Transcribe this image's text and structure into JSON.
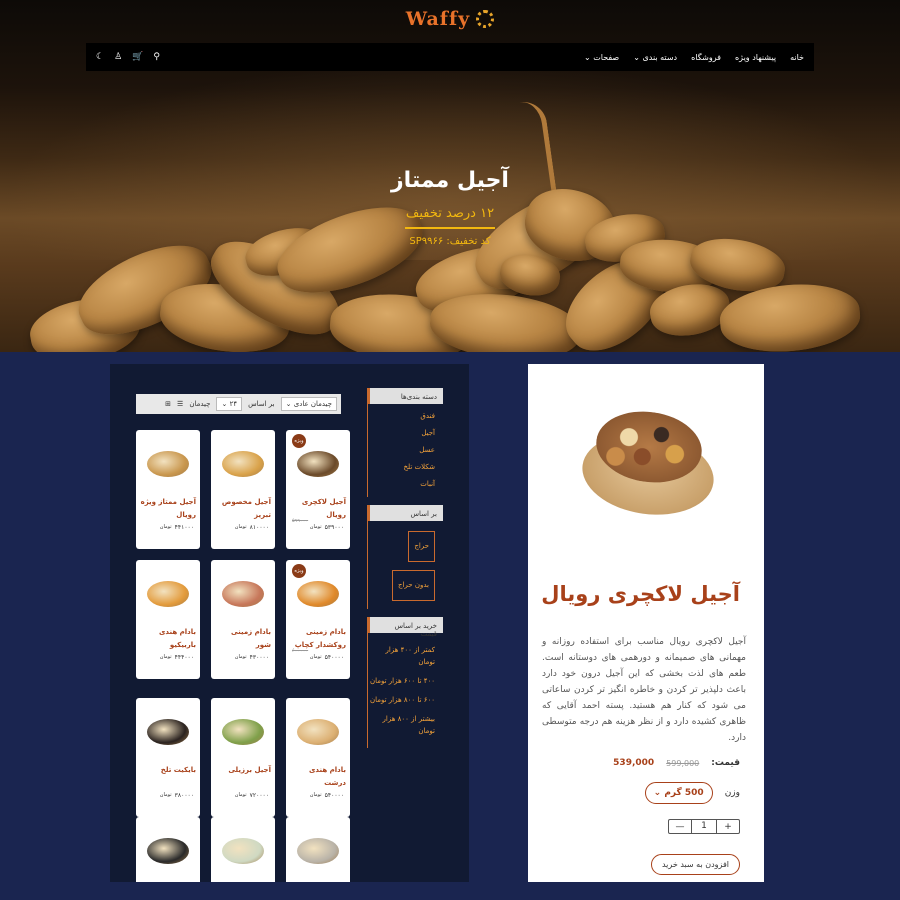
{
  "brand": {
    "name": "Waffy",
    "accent": "#e8722a"
  },
  "nav": {
    "links": [
      "خانه",
      "پیشنهاد ویژه",
      "فروشگاه",
      "دسته بندی",
      "صفحات"
    ],
    "icons": [
      "moon-icon",
      "user-icon",
      "cart-icon",
      "search-icon"
    ]
  },
  "hero": {
    "title": "آجیل ممتاز",
    "discount": "۱۲ درصد تخفیف",
    "code": "کد تخفیف: SP۹۹۶۶"
  },
  "product": {
    "title": "آجیل لاکچری رویال",
    "description": "آجیل لاکچری رویال مناسب برای استفاده روزانه و مهمانی های صمیمانه و دورهمی های دوستانه است. طعم های لذت بخشی که این آجیل درون خود دارد باعث دلپذیر تر کردن و خاطره انگیز تر کردن ساعاتی می شود که کنار هم هستید. پسته احمد آقایی که ظاهری کشیده دارد و از نظر هزینه هم درجه متوسطی دارد.",
    "price_label": "قیمت:",
    "price": "539,000",
    "old_price": "599,000",
    "weight_label": "وزن",
    "weight_value": "500 گرم",
    "quantity": "1",
    "add_to_cart": "افزودن به سبد خرید",
    "colors": {
      "title": "#a8411a"
    }
  },
  "sidebar": {
    "categories_title": "دسته بندی‌ها",
    "categories": [
      "فندق",
      "آجیل",
      "عسل",
      "شکلات تلخ",
      "آنبات"
    ],
    "by_title": "بر اساس",
    "filters": [
      "حراج",
      "بدون حراج"
    ],
    "price_title": "خرید بر اساس قیمت",
    "price_ranges": [
      "کمتر از ۴۰۰ هزار تومان",
      "۴۰۰ تا ۶۰۰ هزار تومان",
      "۶۰۰ تا ۸۰۰ هزار تومان",
      "بیشتر از ۸۰۰ هزار تومان"
    ]
  },
  "toolbar": {
    "sort_label": "بر اساس",
    "sort_value": "چیدمان عادی",
    "per_page": "۲۴",
    "layout_label": "چیدمان"
  },
  "products_grid": [
    {
      "name": "آجیل لاکچری رویال",
      "price": "۵۳۹۰۰۰",
      "old": "۵۹۹۰۰۰",
      "currency": "تومان",
      "badge": "ویژه",
      "color": "#6b4a2a"
    },
    {
      "name": "آجیل مخصوص تبریز",
      "price": "۸۱۰۰۰۰",
      "currency": "تومان",
      "color": "#d9a24a"
    },
    {
      "name": "آجیل ممتاز ویژه رویال",
      "price": "۴۴۱۰۰۰",
      "currency": "تومان",
      "color": "#c9974e"
    },
    {
      "name": "بادام زمینی روکشدار کچاپ",
      "price": "۵۴۰۰۰۰",
      "old": "۶۰۰۰۰۰",
      "currency": "تومان",
      "badge": "ویژه",
      "color": "#e0892a"
    },
    {
      "name": "بادام زمینی شور",
      "price": "۴۳۰۰۰۰",
      "currency": "تومان",
      "color": "#c7775a"
    },
    {
      "name": "بادام هندی باربیکیو",
      "price": "۴۴۴۰۰۰",
      "currency": "تومان",
      "color": "#e39b3c"
    },
    {
      "name": "بادام هندی درشت",
      "price": "۵۴۰۰۰۰",
      "currency": "تومان",
      "color": "#dcb073"
    },
    {
      "name": "آجیل برزیلی",
      "price": "۷۲۰۰۰۰",
      "currency": "تومان",
      "color": "#7fa04a"
    },
    {
      "name": "بایکیت تلخ",
      "price": "۳۸۰۰۰۰",
      "currency": "تومان",
      "color": "#2b2320"
    },
    {
      "name": "",
      "price": "",
      "currency": "",
      "color": "#b9b3a8"
    },
    {
      "name": "",
      "price": "",
      "currency": "",
      "color": "#cfd9c2"
    },
    {
      "name": "",
      "price": "",
      "currency": "",
      "color": "#2a2a2a"
    }
  ]
}
